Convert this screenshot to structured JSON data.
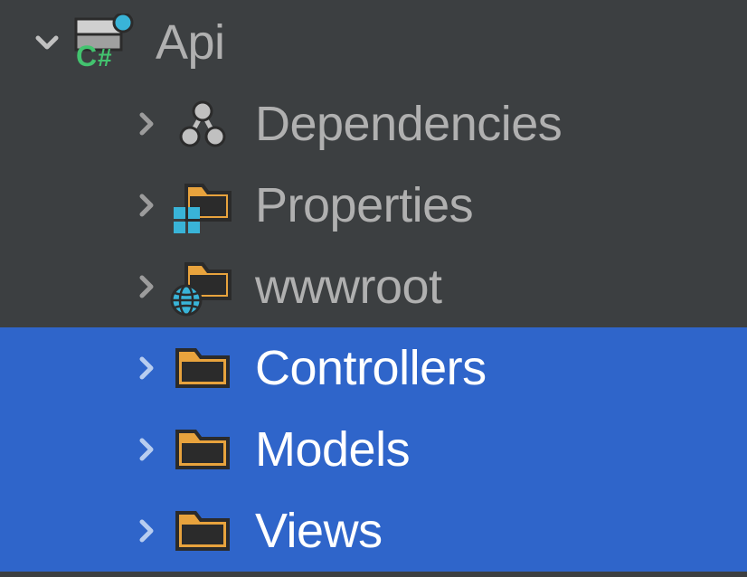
{
  "tree": {
    "root": {
      "label": "Api",
      "expanded": true,
      "icon": "csharp-project-icon"
    },
    "children": [
      {
        "label": "Dependencies",
        "icon": "dependencies-icon",
        "selected": false
      },
      {
        "label": "Properties",
        "icon": "properties-folder-icon",
        "selected": false
      },
      {
        "label": "wwwroot",
        "icon": "wwwroot-folder-icon",
        "selected": false
      },
      {
        "label": "Controllers",
        "icon": "folder-icon",
        "selected": true
      },
      {
        "label": "Models",
        "icon": "folder-icon",
        "selected": true
      },
      {
        "label": "Views",
        "icon": "folder-icon",
        "selected": true
      }
    ]
  },
  "colors": {
    "bg": "#3c3f41",
    "selection": "#2f65ca",
    "text_muted": "#b0b0b0",
    "text_selected": "#ffffff",
    "folder_fill": "#e8a33d",
    "folder_inner": "#2b2b2b",
    "chevron": "#9c9c9c",
    "csharp_green": "#43c36f",
    "accent_blue": "#39b4d8"
  }
}
